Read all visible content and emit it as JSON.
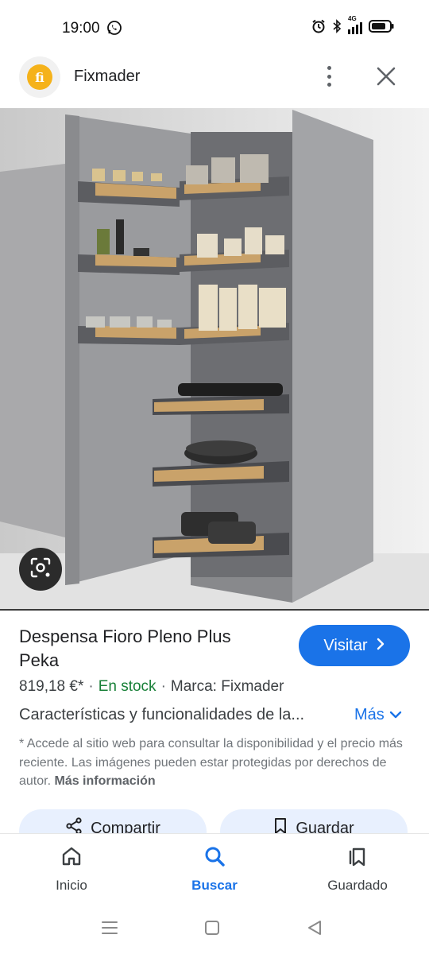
{
  "status": {
    "time": "19:00",
    "network": "4G"
  },
  "header": {
    "logo_text": "fi",
    "site_name": "Fixmader"
  },
  "product": {
    "title": "Despensa Fioro Pleno Plus Peka",
    "visit_label": "Visitar",
    "price": "819,18 €*",
    "stock": "En stock",
    "brand": "Marca: Fixmader",
    "features": "Características y funcionalidades de la...",
    "more_label": "Más",
    "disclaimer": "* Accede al sitio web para consultar la disponibilidad y el precio más reciente. Las imágenes pueden estar protegidas por derechos de autor.",
    "more_info_label": "Más información"
  },
  "actions": {
    "share_label": "Compartir",
    "save_label": "Guardar"
  },
  "bottom_nav": {
    "home_label": "Inicio",
    "search_label": "Buscar",
    "saved_label": "Guardado"
  },
  "colors": {
    "accent": "#1a73e8",
    "stock": "#188038",
    "logo": "#f5b21a"
  }
}
